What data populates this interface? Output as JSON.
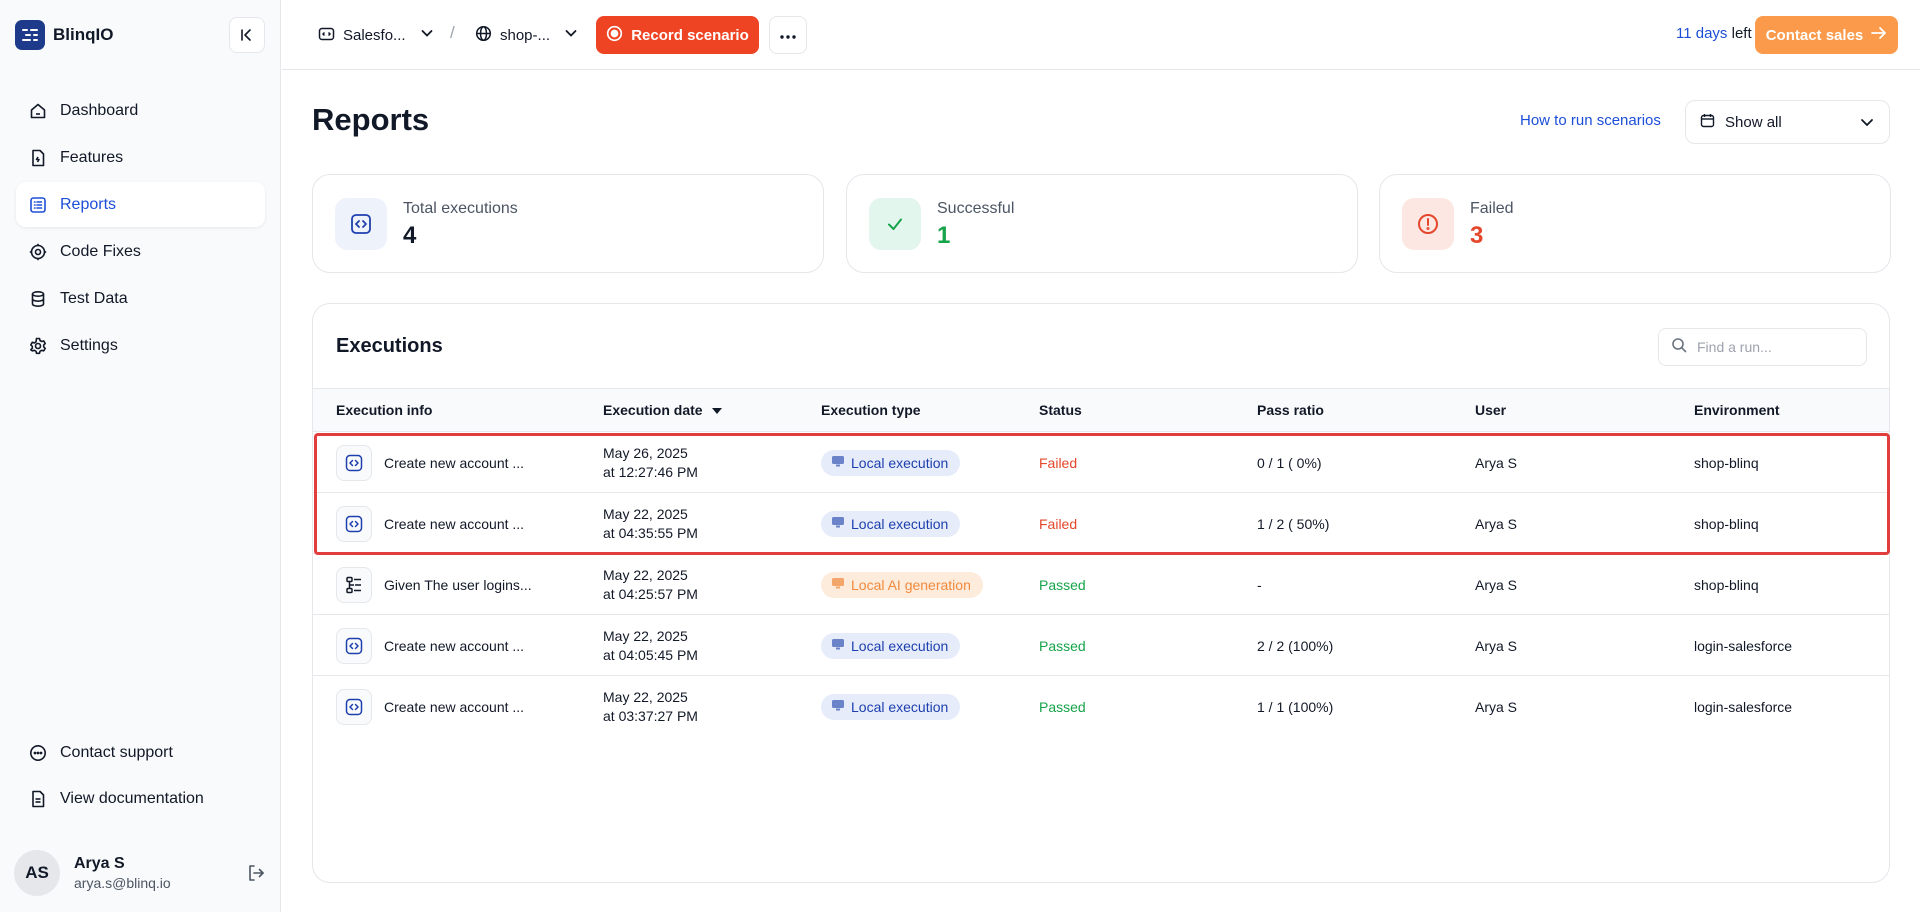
{
  "app": {
    "name": "BlinqIO"
  },
  "sidebar": {
    "items": [
      {
        "label": "Dashboard",
        "icon": "home-icon"
      },
      {
        "label": "Features",
        "icon": "feature-icon"
      },
      {
        "label": "Reports",
        "icon": "list-icon",
        "active": true
      },
      {
        "label": "Code Fixes",
        "icon": "gear-bug-icon"
      },
      {
        "label": "Test Data",
        "icon": "database-icon"
      },
      {
        "label": "Settings",
        "icon": "settings-icon"
      }
    ],
    "bottom_items": [
      {
        "label": "Contact support",
        "icon": "chat-icon"
      },
      {
        "label": "View documentation",
        "icon": "document-icon"
      }
    ],
    "user": {
      "initials": "AS",
      "name": "Arya S",
      "email": "arya.s@blinq.io"
    }
  },
  "topbar": {
    "project": "Salesfo...",
    "separator": "/",
    "environment": "shop-...",
    "record_label": "Record scenario",
    "trial_days": "11 days",
    "trial_suffix": " left",
    "contact_label": "Contact sales"
  },
  "page": {
    "title": "Reports",
    "how_link": "How to run scenarios",
    "filter_value": "Show all"
  },
  "stats": {
    "total": {
      "label": "Total executions",
      "value": "4"
    },
    "successful": {
      "label": "Successful",
      "value": "1"
    },
    "failed": {
      "label": "Failed",
      "value": "3"
    }
  },
  "executions": {
    "title": "Executions",
    "search_placeholder": "Find a run...",
    "columns": [
      "Execution info",
      "Execution date",
      "Execution type",
      "Status",
      "Pass ratio",
      "User",
      "Environment"
    ],
    "rows": [
      {
        "info": "Create new account ...",
        "date1": "May 26, 2025",
        "date2": "at 12:27:46 PM",
        "type": "Local execution",
        "type_kind": "local",
        "status": "Failed",
        "ratio": "0 / 1 ( 0%)",
        "user": "Arya S",
        "env": "shop-blinq"
      },
      {
        "info": "Create new account ...",
        "date1": "May 22, 2025",
        "date2": "at 04:35:55 PM",
        "type": "Local execution",
        "type_kind": "local",
        "status": "Failed",
        "ratio": "1 / 2 ( 50%)",
        "user": "Arya S",
        "env": "shop-blinq"
      },
      {
        "info": "Given The user logins...",
        "date1": "May 22, 2025",
        "date2": "at 04:25:57 PM",
        "type": "Local AI generation",
        "type_kind": "ai",
        "status": "Passed",
        "ratio": "-",
        "user": "Arya S",
        "env": "shop-blinq"
      },
      {
        "info": "Create new account ...",
        "date1": "May 22, 2025",
        "date2": "at 04:05:45 PM",
        "type": "Local execution",
        "type_kind": "local",
        "status": "Passed",
        "ratio": "2 / 2 (100%)",
        "user": "Arya S",
        "env": "login-salesforce"
      },
      {
        "info": "Create new account ...",
        "date1": "May 22, 2025",
        "date2": "at 03:37:27 PM",
        "type": "Local execution",
        "type_kind": "local",
        "status": "Passed",
        "ratio": "1 / 1 (100%)",
        "user": "Arya S",
        "env": "login-salesforce"
      }
    ]
  },
  "colors": {
    "brand": "#1e3a8a",
    "accent": "#1d4ed8",
    "record": "#ef4424",
    "contact": "#fb9a4b",
    "failed": "#e4472b",
    "passed": "#16a34a",
    "highlight": "#e23d3d"
  }
}
